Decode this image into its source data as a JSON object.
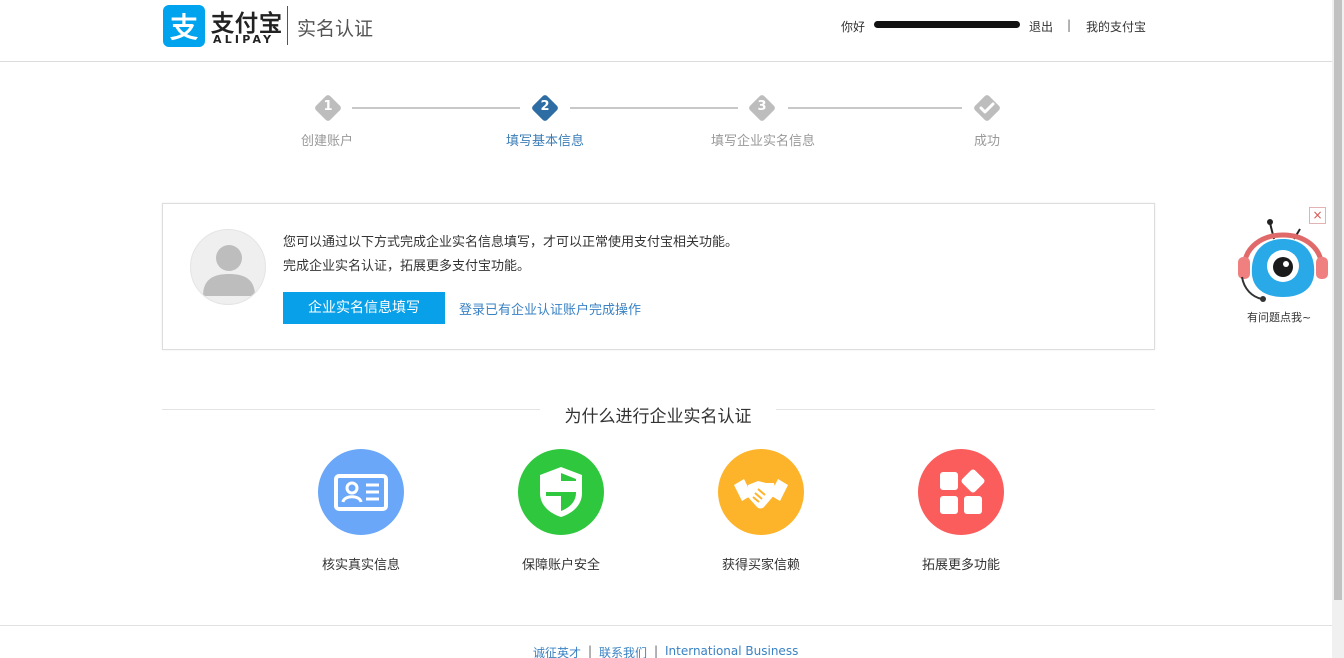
{
  "header": {
    "logo_cn": "支付宝",
    "logo_en": "ALIPAY",
    "page_title": "实名认证",
    "hello": "你好",
    "logout": "退出",
    "separator": "|",
    "my_alipay": "我的支付宝"
  },
  "steps": [
    {
      "num": "1",
      "label": "创建账户",
      "state": "done"
    },
    {
      "num": "2",
      "label": "填写基本信息",
      "state": "active"
    },
    {
      "num": "3",
      "label": "填写企业实名信息",
      "state": "todo"
    },
    {
      "num": "",
      "label": "成功",
      "state": "todo",
      "icon": "check-icon"
    }
  ],
  "info": {
    "line1": "您可以通过以下方式完成企业实名信息填写，才可以正常使用支付宝相关功能。",
    "line2": "完成企业实名认证，拓展更多支付宝功能。",
    "primary_button": "企业实名信息填写",
    "secondary_link": "登录已有企业认证账户完成操作"
  },
  "why": {
    "title": "为什么进行企业实名认证",
    "features": [
      {
        "label": "核实真实信息",
        "icon": "id-card-icon",
        "color": "#6aa7f8"
      },
      {
        "label": "保障账户安全",
        "icon": "shield-icon",
        "color": "#2fc73d"
      },
      {
        "label": "获得买家信赖",
        "icon": "handshake-icon",
        "color": "#fdb42b"
      },
      {
        "label": "拓展更多功能",
        "icon": "apps-icon",
        "color": "#fb5c5c"
      }
    ]
  },
  "footer": {
    "links": [
      "诚征英才",
      "联系我们",
      "International Business"
    ],
    "separator": "|"
  },
  "helper": {
    "text": "有问题点我~",
    "close": "×"
  },
  "colors": {
    "brand": "#00a3ee",
    "step_active": "#2e6da4",
    "link": "#3a82c3",
    "button": "#08a0e9"
  }
}
